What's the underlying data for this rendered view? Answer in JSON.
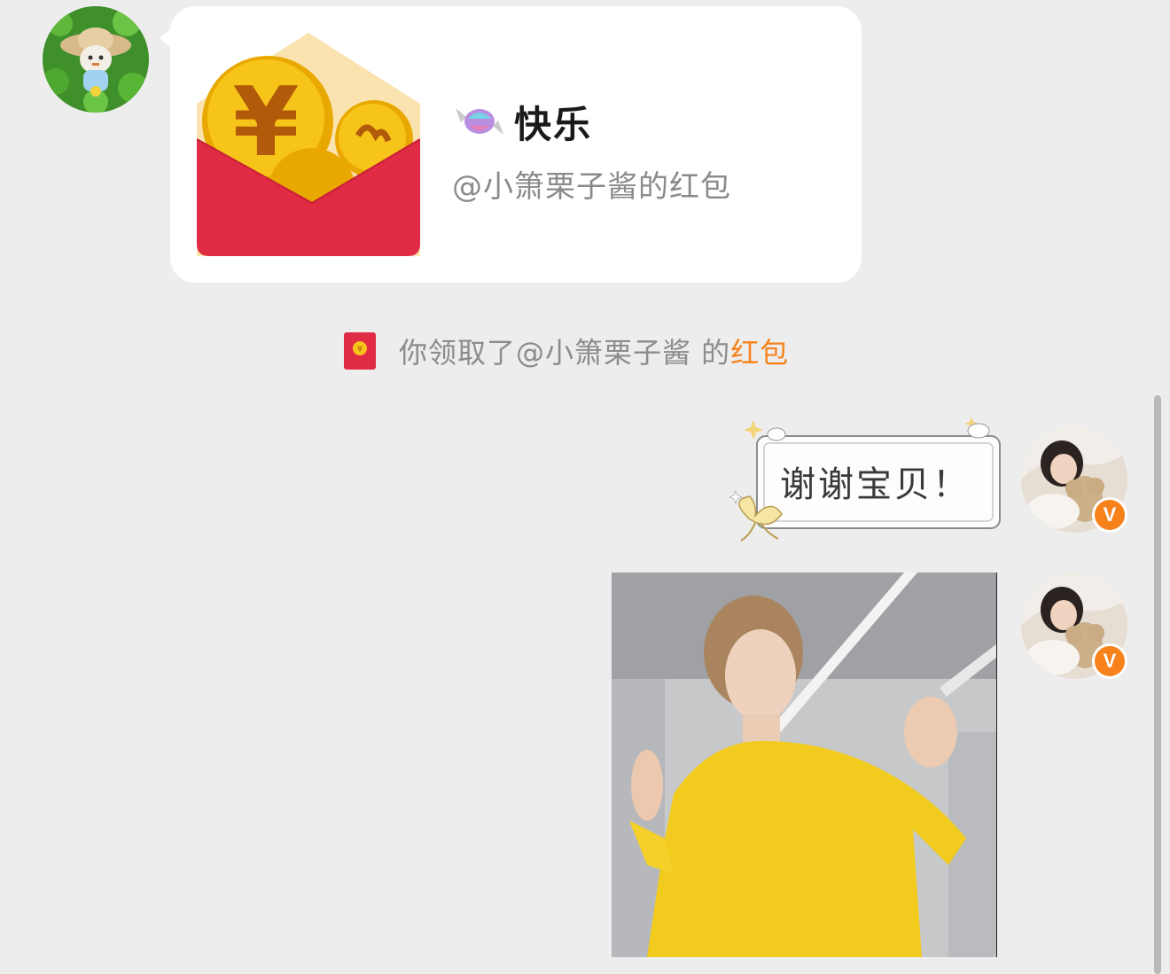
{
  "red_packet": {
    "title": "快乐",
    "title_icon": "candy-icon",
    "sender_line": "@小箫栗子酱的红包",
    "icon": "red-envelope-icon",
    "colors": {
      "envelope": "#e02b45",
      "coin": "#f5b800",
      "card_bg": "#ffffff"
    }
  },
  "notice": {
    "icon": "small-red-envelope-icon",
    "text": "你领取了@小箫栗子酱 的",
    "link": "红包",
    "link_color": "#f7821b"
  },
  "messages": {
    "reply_text": "谢谢宝贝！",
    "image_alt_icon": "photo-icon"
  },
  "avatars": {
    "left_icon": "avatar-icon",
    "right_icon": "avatar-icon",
    "verified_glyph": "V",
    "verified_color": "#f7821b"
  },
  "theme": {
    "background": "#ededed"
  }
}
